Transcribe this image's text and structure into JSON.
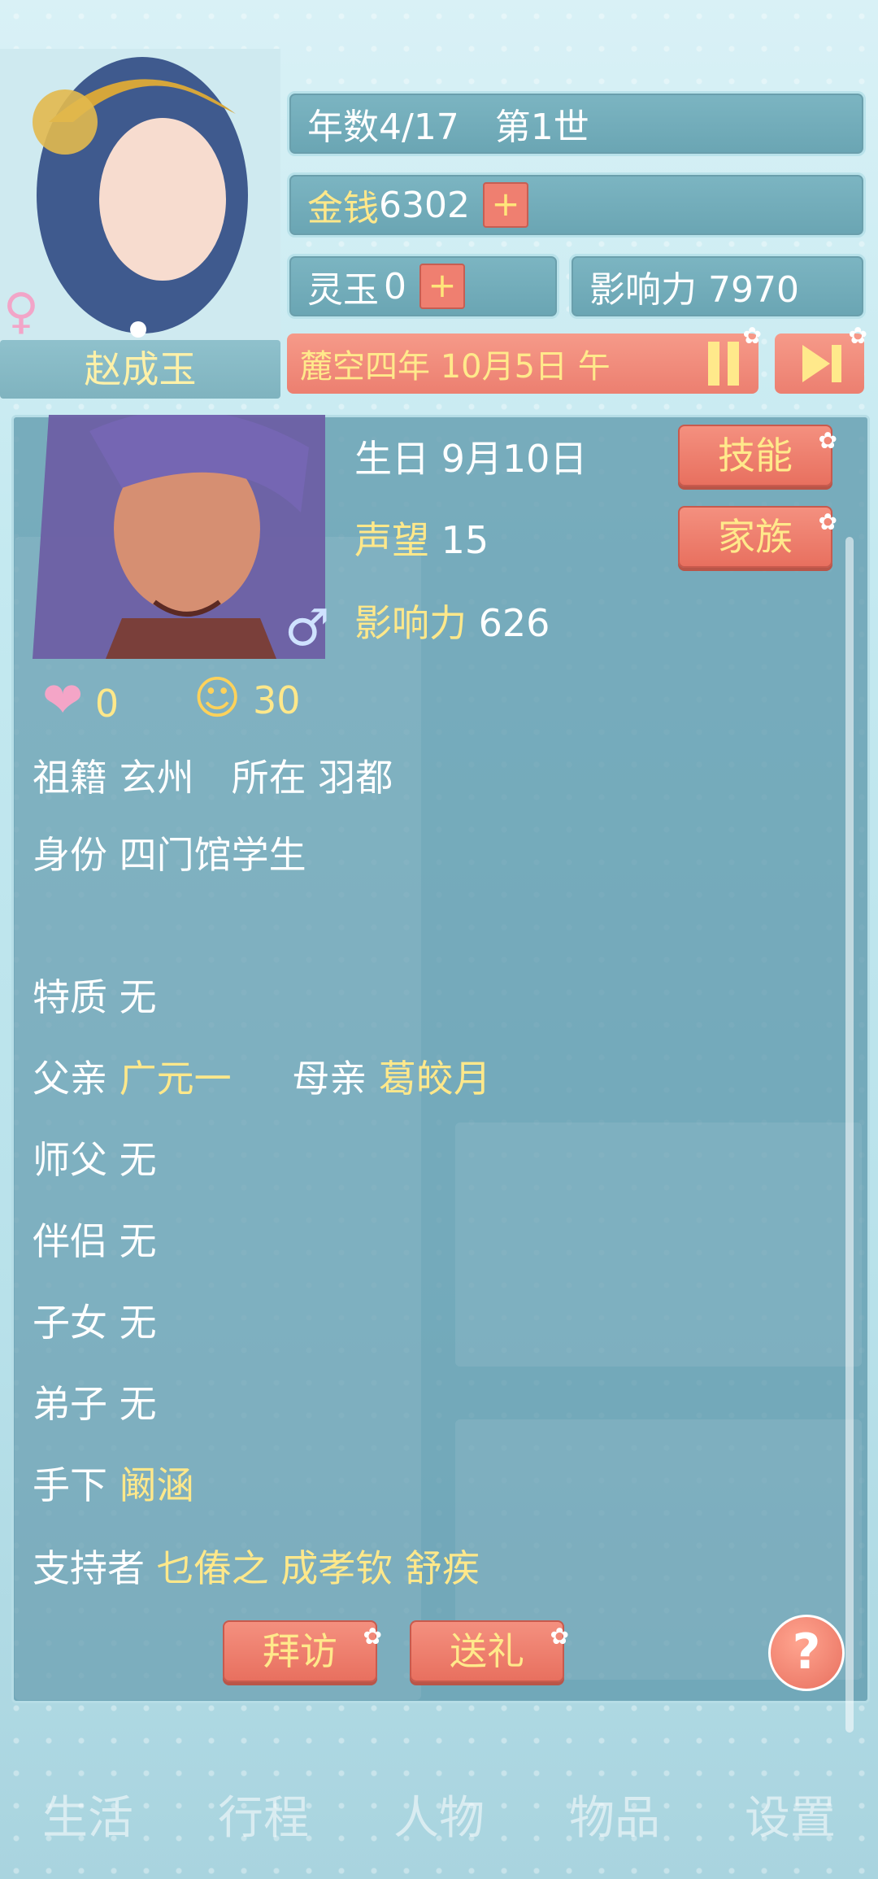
{
  "header": {
    "year_info": "年数4/17　第1世",
    "money_label": "金钱",
    "money_value": "6302",
    "plus": "+",
    "jade_label": "灵玉",
    "jade_value": "0",
    "influence": "影响力 7970",
    "player_name": "赵成玉",
    "date": "麓空四年 10月5日 午"
  },
  "character": {
    "birthday": "生日 9月10日",
    "prestige_label": "声望",
    "prestige_value": "15",
    "influence_label": "影响力",
    "influence_value": "626",
    "love": "0",
    "mood": "30",
    "origin": "祖籍 玄州　所在 羽都",
    "identity": "身份 四门馆学生",
    "trait": "特质 无",
    "father_label": "父亲",
    "father": "广元一",
    "mother_label": "母亲",
    "mother": "葛皎月",
    "master": "师父 无",
    "partner": "伴侣 无",
    "children": "子女 无",
    "disciples": "弟子 无",
    "subordinate_label": "手下",
    "subordinate": "阚涵",
    "supporters_label": "支持者",
    "supporters": "乜偆之 成孝钦 舒疾"
  },
  "buttons": {
    "skills": "技能",
    "family": "家族",
    "visit": "拜访",
    "gift": "送礼",
    "help": "?"
  },
  "nav": [
    "生活",
    "行程",
    "人物",
    "物品",
    "设置"
  ],
  "colors": {
    "accent": "#ec7f70",
    "gold": "#ffe88a",
    "panel": "#609aad"
  }
}
